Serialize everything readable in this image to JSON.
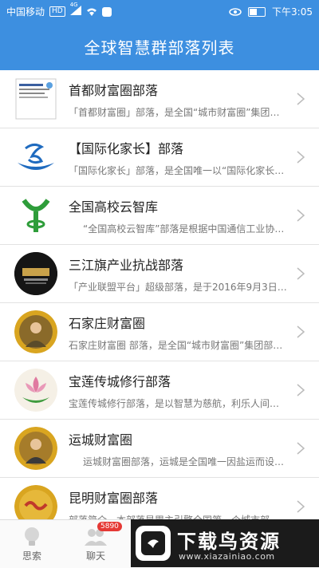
{
  "status": {
    "carrier": "中国移动",
    "hd": "HD",
    "signal": "4G",
    "time": "下午3:05",
    "battery_level": 0.5
  },
  "header": {
    "title": "全球智慧群部落列表"
  },
  "tribes": [
    {
      "title": "首都财富圈部落",
      "desc": "「首都财富圈」部落，是全国“城市财富圈”集团部…"
    },
    {
      "title": "【国际化家长】部落",
      "desc": "「国际化家长」部落，是全国唯一以“国际化家长”…"
    },
    {
      "title": "全国高校云智库",
      "desc": "“全国高校云智库”部落是根据中国通信工业协…"
    },
    {
      "title": "三江旗产业抗战部落",
      "desc": "「产业联盟平台」超级部落，是于2016年9月3日…"
    },
    {
      "title": "石家庄财富圈",
      "desc": "石家庄财富圈 部落，是全国“城市财富圈”集团部落…"
    },
    {
      "title": "宝莲传城修行部落",
      "desc": "宝莲传城修行部落，是以智慧为慈航，利乐人间的…"
    },
    {
      "title": "运城财富圈",
      "desc": "运城财富圈部落，运城是全国唯一因盐运而设…"
    },
    {
      "title": "昆明财富圈部落",
      "desc": "部落简介，本部落是胃主引擎全国第一个城市部落…"
    }
  ],
  "tabbar": {
    "tabs": [
      {
        "label": "思索"
      },
      {
        "label": "聊天",
        "badge": "5890"
      }
    ]
  },
  "watermark": {
    "brand": "下载鸟资源",
    "url": "www.xiazainiao.com"
  }
}
